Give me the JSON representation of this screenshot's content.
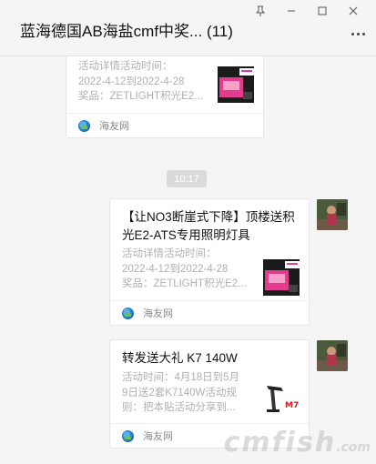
{
  "window": {
    "title": "蓝海德国AB海盐cmf中奖... (11)",
    "pin_icon": "pin-icon",
    "minimize_icon": "minimize-icon",
    "maximize_icon": "maximize-icon",
    "close_icon": "close-icon"
  },
  "messages": {
    "timestamp": "10:17",
    "cards": [
      {
        "title": "",
        "desc_lines": [
          "活动详情活动时间：",
          "2022-4-12到2022-4-28",
          "奖品：ZETLIGHT积光E2..."
        ],
        "source": "海友网",
        "thumb": "led-light-ad-thumbnail"
      },
      {
        "title_lines": [
          "【让NO3断崖式下降】顶楼送积",
          "光E2-ATS专用照明灯具"
        ],
        "desc_lines": [
          "活动详情活动时间：",
          "2022-4-12到2022-4-28",
          "奖品：ZETLIGHT积光E2..."
        ],
        "source": "海友网",
        "thumb": "led-light-ad-thumbnail"
      },
      {
        "title_lines": [
          "转发送大礼 K7 140W"
        ],
        "desc_lines": [
          "活动时间：4月18日到5月",
          "9日送2套K7140W活动规",
          "则：把本贴活动分享到..."
        ],
        "source": "海友网",
        "thumb": "k7-lamp-thumbnail"
      }
    ]
  },
  "watermark": {
    "main": "cmfish",
    "suffix": ".com"
  }
}
